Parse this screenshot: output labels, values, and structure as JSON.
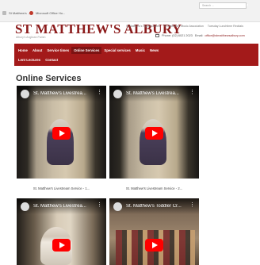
{
  "browser": {
    "tabs": [
      {
        "label": "St Matthew's ..."
      },
      {
        "label": "Microsoft Office Ho..."
      }
    ]
  },
  "header": {
    "site_title": "ST MATTHEW'S ALBURY",
    "tagline": "Albury's Anglican Parish",
    "top_links": [
      "St Matthew's Opportunities",
      "St Matthew's Music Association",
      "Tuesday Lunchtime Recitals"
    ],
    "phone": "Phone: (02) 6021 2023",
    "email_label": "Email:",
    "email": "office@stmatthewsalbury.com"
  },
  "nav": {
    "row1": [
      "Home",
      "About",
      "Service times",
      "Online Services",
      "Special services",
      "Music",
      "News"
    ],
    "row2": [
      "Lent Lectures",
      "Contact"
    ],
    "active": "Online Services",
    "search_placeholder": "Search ...",
    "search_icon": "search-icon"
  },
  "main": {
    "heading": "Online Services",
    "videos": [
      {
        "title": "St. Matthew's Livestrea...",
        "caption": "St. Matthew's Livestream Service - 1..."
      },
      {
        "title": "St. Matthew's Livestrea...",
        "caption": "St. Matthew's Livestream Service - 2..."
      },
      {
        "title": "St. Matthew's Livestrea..."
      },
      {
        "title": "St. Matthew's Toddler Cr..."
      }
    ]
  },
  "colors": {
    "brand": "#a31a1a",
    "title": "#8b1a1a",
    "play": "#ff0000"
  }
}
